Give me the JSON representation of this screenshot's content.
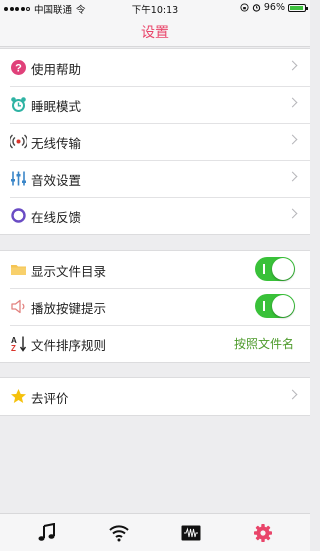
{
  "status_bar": {
    "carrier": "中国联通",
    "network": "令",
    "time": "下午10:13",
    "battery_text": "96%",
    "battery_level": 0.96
  },
  "nav": {
    "title": "设置"
  },
  "group1": [
    {
      "label": "使用帮助",
      "icon": "help-icon"
    },
    {
      "label": "睡眠模式",
      "icon": "alarm-clock-icon"
    },
    {
      "label": "无线传输",
      "icon": "wireless-transfer-icon"
    },
    {
      "label": "音效设置",
      "icon": "equalizer-icon"
    },
    {
      "label": "在线反馈",
      "icon": "feedback-ring-icon"
    }
  ],
  "group2": {
    "show_folders": {
      "label": "显示文件目录",
      "icon": "folder-icon",
      "on": true
    },
    "key_sound": {
      "label": "播放按键提示",
      "icon": "speaker-icon",
      "on": true
    },
    "sort_rule": {
      "label": "文件排序规则",
      "icon": "sort-az-icon",
      "value": "按照文件名"
    }
  },
  "group3": [
    {
      "label": "去评价",
      "icon": "star-icon"
    }
  ],
  "tabs": [
    {
      "name": "music",
      "icon": "music-note-icon"
    },
    {
      "name": "wifi",
      "icon": "wifi-icon"
    },
    {
      "name": "visualizer",
      "icon": "waveform-icon"
    },
    {
      "name": "settings",
      "icon": "gear-icon",
      "active": true
    }
  ],
  "colors": {
    "accent": "#e9456a",
    "toggle_on": "#39c139",
    "value_green": "#4c9a2a",
    "background": "#ededef"
  }
}
